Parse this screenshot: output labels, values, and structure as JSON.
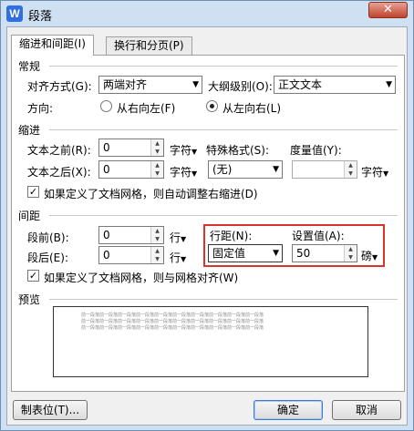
{
  "window": {
    "title": "段落",
    "close_glyph": "✕",
    "app_icon_letter": "W"
  },
  "tabs": [
    {
      "label": "缩进和间距(I)",
      "active": true
    },
    {
      "label": "换行和分页(P)",
      "active": false
    }
  ],
  "general": {
    "section": "常规",
    "align_label": "对齐方式(G):",
    "align_value": "两端对齐",
    "outline_label": "大纲级别(O):",
    "outline_value": "正文文本",
    "direction_label": "方向:",
    "rtl_label": "从右向左(F)",
    "ltr_label": "从左向右(L)"
  },
  "indent": {
    "section": "缩进",
    "before_label": "文本之前(R):",
    "before_value": "0",
    "before_unit": "字符",
    "after_label": "文本之后(X):",
    "after_value": "0",
    "after_unit": "字符",
    "special_label": "特殊格式(S):",
    "special_value": "(无)",
    "measure_label": "度量值(Y):",
    "measure_value": "",
    "measure_unit": "字符",
    "grid_check_label": "如果定义了文档网格，则自动调整右缩进(D)"
  },
  "spacing": {
    "section": "间距",
    "before_label": "段前(B):",
    "before_value": "0",
    "before_unit": "行",
    "after_label": "段后(E):",
    "after_value": "0",
    "after_unit": "行",
    "line_label": "行距(N):",
    "line_value": "固定值",
    "setting_label": "设置值(A):",
    "setting_value": "50",
    "setting_unit": "磅",
    "grid_check_label": "如果定义了文档网格，则与网格对齐(W)"
  },
  "preview": {
    "section": "预览",
    "lines": [
      "前一段落前一段落前一段落前一段落前一段落前一段落前一段落前一段落前一段落前一段落",
      "前一段落前一段落前一段落前一段落前一段落前一段落前一段落前一段落前一段落前一段落",
      "前一段落前一段落前一段落前一段落前一段落前一段落前一段落前一段落前一段落前一段落"
    ]
  },
  "buttons": {
    "tabs": "制表位(T)...",
    "ok": "确定",
    "cancel": "取消"
  }
}
